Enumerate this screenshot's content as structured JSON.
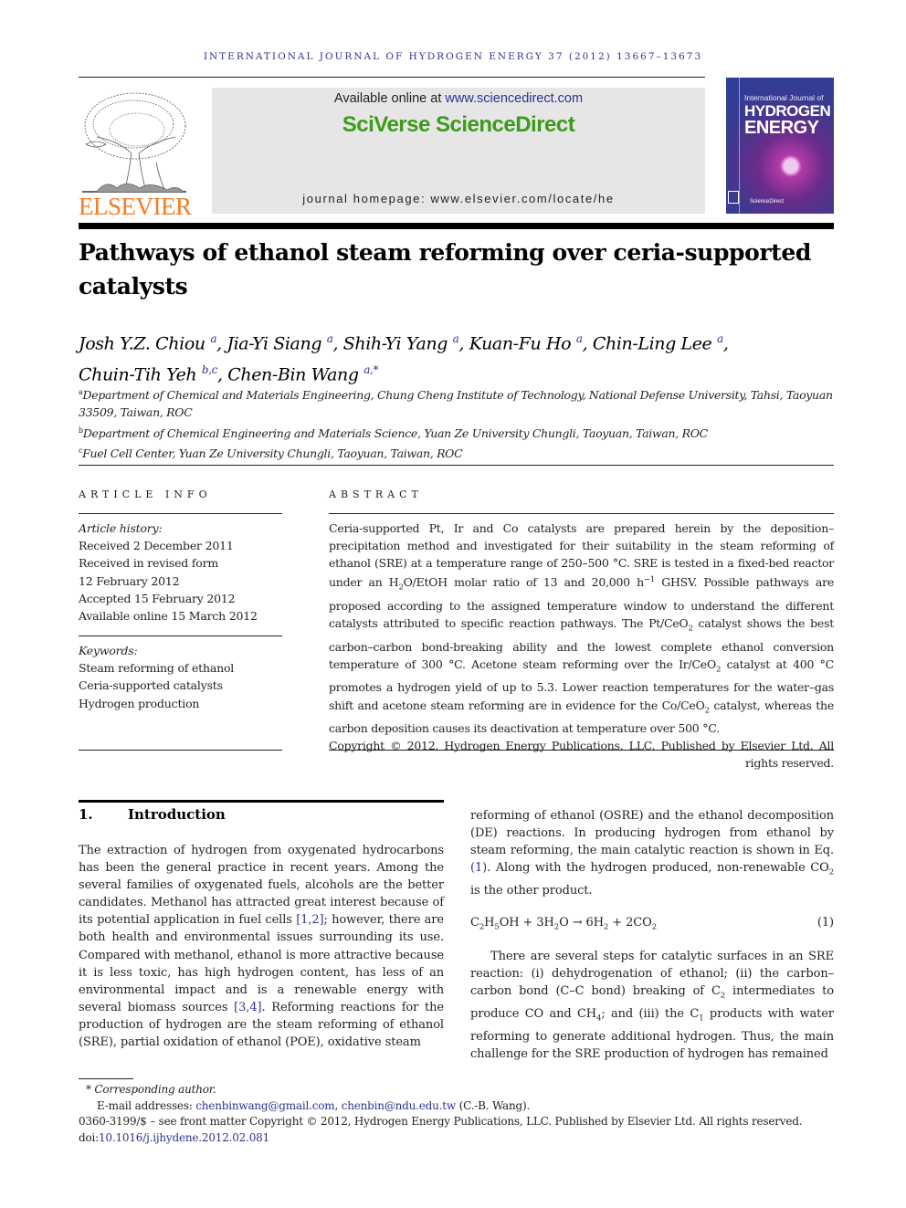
{
  "header": {
    "running_head": "INTERNATIONAL JOURNAL OF HYDROGEN ENERGY 37 (2012) 13667–13673",
    "publisher_name": "ELSEVIER",
    "banner": {
      "available_prefix": "Available online at ",
      "available_link": "www.sciencedirect.com",
      "brand": "SciVerse ScienceDirect",
      "homepage": "journal homepage: www.elsevier.com/locate/he"
    },
    "cover": {
      "line1": "International Journal of",
      "line2": "HYDROGEN",
      "line3": "ENERGY",
      "footer": "ScienceDirect"
    },
    "colors": {
      "elsevier_orange": "#f47b20",
      "sciverse_green": "#3c9b1a",
      "link_blue": "#2e3192"
    }
  },
  "article": {
    "title": "Pathways of ethanol steam reforming over ceria-supported catalysts",
    "authors": [
      {
        "name": "Josh Y.Z. Chiou",
        "aff": "a"
      },
      {
        "name": "Jia-Yi Siang",
        "aff": "a"
      },
      {
        "name": "Shih-Yi Yang",
        "aff": "a"
      },
      {
        "name": "Kuan-Fu Ho",
        "aff": "a"
      },
      {
        "name": "Chin-Ling Lee",
        "aff": "a"
      },
      {
        "name": "Chuin-Tih Yeh",
        "aff": "b,c"
      },
      {
        "name": "Chen-Bin Wang",
        "aff": "a,*"
      }
    ],
    "affiliations": [
      {
        "key": "a",
        "text": "Department of Chemical and Materials Engineering, Chung Cheng Institute of Technology, National Defense University, Tahsi, Taoyuan 33509, Taiwan, ROC"
      },
      {
        "key": "b",
        "text": "Department of Chemical Engineering and Materials Science, Yuan Ze University Chungli, Taoyuan, Taiwan, ROC"
      },
      {
        "key": "c",
        "text": "Fuel Cell Center, Yuan Ze University Chungli, Taoyuan, Taiwan, ROC"
      }
    ]
  },
  "article_info": {
    "heading": "ARTICLE INFO",
    "history_label": "Article history:",
    "history": [
      "Received 2 December 2011",
      "Received in revised form",
      "12 February 2012",
      "Accepted 15 February 2012",
      "Available online 15 March 2012"
    ],
    "keywords_label": "Keywords:",
    "keywords": [
      "Steam reforming of ethanol",
      "Ceria-supported catalysts",
      "Hydrogen production"
    ]
  },
  "abstract": {
    "heading": "ABSTRACT",
    "p1": "Ceria-supported Pt, Ir and Co catalysts are prepared herein by the deposition–precipitation method and investigated for their suitability in the steam reforming of ethanol (SRE) at a temperature range of 250–500 °C. SRE is tested in a fixed-bed reactor under an ",
    "p2": "O/EtOH molar ratio of 13 and 20,000 h",
    "p3": " GHSV. Possible pathways are proposed according to the assigned temperature window to understand the different catalysts attributed to specific reaction pathways. The Pt/CeO",
    "p4": " catalyst shows the best carbon–carbon bond-breaking ability and the lowest complete ethanol conversion temperature of 300 °C. Acetone steam reforming over the Ir/CeO",
    "p5": " catalyst at 400 °C promotes a hydrogen yield of up to 5.3. Lower reaction temperatures for the water–gas shift and acetone steam reforming are in evidence for the Co/CeO",
    "p6": " catalyst, whereas the carbon deposition causes its deactivation at temperature over 500 °C.",
    "h2": "H",
    "sub2": "2",
    "sup_m1": "−1",
    "copyright": "Copyright © 2012, Hydrogen Energy Publications, LLC. Published by Elsevier Ltd. All rights reserved."
  },
  "introduction": {
    "number": "1.",
    "title": "Introduction",
    "left_a": "The extraction of hydrogen from oxygenated hydrocarbons has been the general practice in recent years. Among the several families of oxygenated fuels, alcohols are the better candidates. Methanol has attracted great interest because of its potential application in fuel cells ",
    "ref1": "[1,2]",
    "left_b": "; however, there are both health and environmental issues surrounding its use. Compared with methanol, ethanol is more attractive because it is less toxic, has high hydrogen content, has less of an environmental impact and is a renewable energy with several biomass sources ",
    "ref2": "[3,4]",
    "left_c": ". Reforming reactions for the production of hydrogen are the steam reforming of ethanol (SRE), partial oxidation of ethanol (POE), oxidative steam",
    "right_a": "reforming of ethanol (OSRE) and the ethanol decomposition (DE) reactions. In producing hydrogen from ethanol by steam reforming, the main catalytic reaction is shown in Eq. ",
    "eq_ref": "(1)",
    "right_b": ". Along with the hydrogen produced, non-renewable CO",
    "right_c": " is the other product.",
    "equation_number": "(1)",
    "para2_a": "There are several steps for catalytic surfaces in an SRE reaction: (i) dehydrogenation of ethanol; (ii) the carbon–carbon bond (C–C bond) breaking of C",
    "para2_b": " intermediates to produce CO and CH",
    "para2_c": "; and (iii) the C",
    "para2_d": " products with water reforming to generate additional hydrogen. Thus, the main challenge for the SRE production of hydrogen has remained",
    "sub2": "2",
    "sub4": "4",
    "sub1": "1"
  },
  "equation": {
    "parts": [
      "C",
      "2",
      "H",
      "5",
      "OH + 3H",
      "2",
      "O → 6H",
      "2",
      " + 2CO",
      "2"
    ]
  },
  "footnotes": {
    "corresponding": "* Corresponding author.",
    "email_label": "E-mail addresses: ",
    "email1": "chenbinwang@gmail.com",
    "email_sep": ", ",
    "email2": "chenbin@ndu.edu.tw",
    "email_suffix": " (C.-B. Wang).",
    "issn_line": "0360-3199/$ – see front matter Copyright © 2012, Hydrogen Energy Publications, LLC. Published by Elsevier Ltd. All rights reserved.",
    "doi_label": "doi:",
    "doi": "10.1016/j.ijhydene.2012.02.081"
  }
}
